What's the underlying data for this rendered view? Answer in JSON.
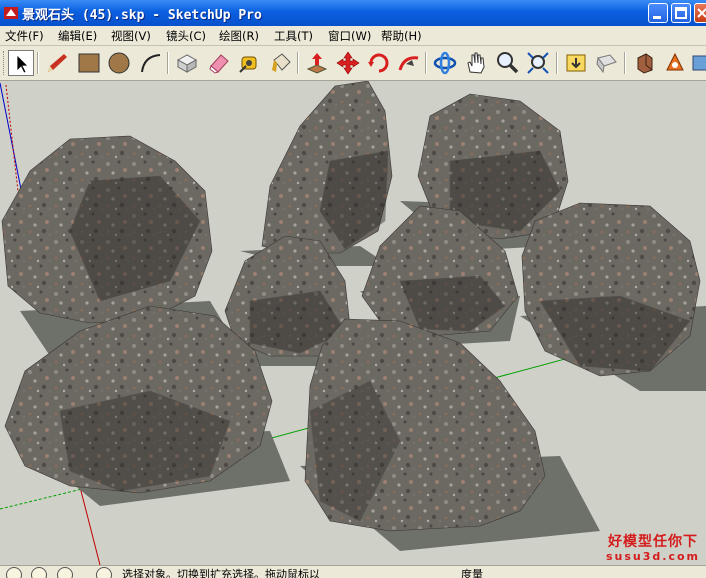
{
  "window": {
    "title": "景观石头 (45).skp - SketchUp Pro",
    "buttons": [
      "minimize",
      "maximize",
      "close"
    ]
  },
  "menu": {
    "items": [
      {
        "label": "文件(F)"
      },
      {
        "label": "编辑(E)"
      },
      {
        "label": "视图(V)"
      },
      {
        "label": "镜头(C)"
      },
      {
        "label": "绘图(R)"
      },
      {
        "label": "工具(T)"
      },
      {
        "label": "窗口(W)"
      },
      {
        "label": "帮助(H)"
      }
    ]
  },
  "toolbar": {
    "tools": [
      {
        "name": "select",
        "icon": "arrow-cursor-icon",
        "active": true
      },
      {
        "name": "line",
        "icon": "pencil-icon"
      },
      {
        "name": "rectangle",
        "icon": "rectangle-icon"
      },
      {
        "name": "circle",
        "icon": "circle-icon"
      },
      {
        "name": "arc",
        "icon": "arc-icon"
      },
      {
        "name": "make-component",
        "icon": "component-icon"
      },
      {
        "name": "eraser",
        "icon": "eraser-icon"
      },
      {
        "name": "tape-measure",
        "icon": "tape-measure-icon"
      },
      {
        "name": "paint-bucket",
        "icon": "paint-bucket-icon"
      },
      {
        "name": "push-pull",
        "icon": "push-pull-icon"
      },
      {
        "name": "move",
        "icon": "move-icon"
      },
      {
        "name": "rotate",
        "icon": "rotate-icon"
      },
      {
        "name": "follow-me",
        "icon": "follow-me-icon"
      },
      {
        "name": "orbit",
        "icon": "orbit-icon"
      },
      {
        "name": "pan",
        "icon": "pan-hand-icon"
      },
      {
        "name": "zoom",
        "icon": "zoom-icon"
      },
      {
        "name": "zoom-extents",
        "icon": "zoom-extents-icon"
      },
      {
        "name": "get-models",
        "icon": "get-models-icon"
      },
      {
        "name": "share-model",
        "icon": "share-model-icon"
      },
      {
        "name": "get-components",
        "icon": "get-components-icon"
      },
      {
        "name": "extension-warehouse",
        "icon": "extension-warehouse-icon"
      }
    ]
  },
  "status": {
    "hint": "选择对象。切换到扩充选择。拖动鼠标以",
    "measurement_label": "度量"
  },
  "watermark": {
    "line1": "好模型任你下",
    "line2": "susu3d.com"
  },
  "colors": {
    "titlebar": "#0a5fe0",
    "viewport_background": "#cfd0c8",
    "rock": "#6a6560",
    "shadow": "#6e706a",
    "axis_red": "#c00000",
    "axis_green": "#00a000",
    "axis_blue": "#0000c8",
    "watermark": "#d41c1c"
  }
}
